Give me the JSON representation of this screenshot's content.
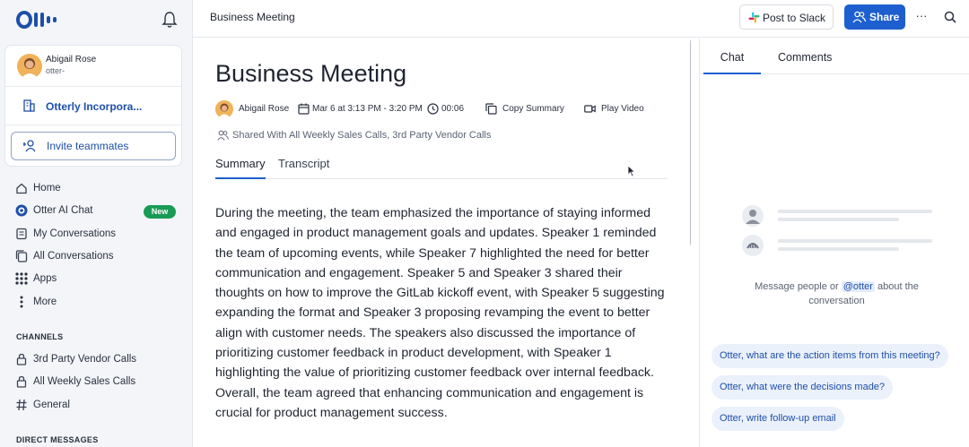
{
  "sidebar": {
    "user": {
      "name": "Abigail Rose",
      "handle": "otter-"
    },
    "org": {
      "name": "Otterly Incorpora..."
    },
    "invite_label": "Invite teammates",
    "nav": [
      {
        "label": "Home",
        "icon": "home-icon"
      },
      {
        "label": "Otter AI Chat",
        "icon": "otter-ai-icon",
        "badge": "New"
      },
      {
        "label": "My Conversations",
        "icon": "conversation-icon"
      },
      {
        "label": "All Conversations",
        "icon": "conversations-icon"
      },
      {
        "label": "Apps",
        "icon": "apps-grid-icon"
      },
      {
        "label": "More",
        "icon": "more-vertical-icon"
      }
    ],
    "channels_header": "CHANNELS",
    "channels": [
      {
        "label": "3rd Party Vendor Calls",
        "icon": "lock-icon"
      },
      {
        "label": "All Weekly Sales Calls",
        "icon": "lock-icon"
      },
      {
        "label": "General",
        "icon": "hash-icon"
      }
    ],
    "dm_header": "DIRECT MESSAGES"
  },
  "topbar": {
    "title": "Business Meeting",
    "slack_label": "Post to Slack",
    "share_label": "Share",
    "more_label": "···"
  },
  "meeting": {
    "title": "Business Meeting",
    "owner": "Abigail Rose",
    "datetime": "Mar 6 at 3:13 PM - 3:20 PM",
    "duration": "00:06",
    "copy_label": "Copy Summary",
    "play_label": "Play Video",
    "shared_with": "Shared With All Weekly Sales Calls, 3rd Party Vendor Calls",
    "tabs": [
      "Summary",
      "Transcript"
    ],
    "summary": "During the meeting, the team emphasized the importance of staying informed and engaged in product management goals and updates. Speaker 1 reminded the team of upcoming events, while Speaker 7 highlighted the need for better communication and engagement. Speaker 5 and Speaker 3 shared their thoughts on how to improve the GitLab kickoff event, with Speaker 5 suggesting expanding the format and Speaker 3 proposing revamping the event to better align with customer needs. The speakers also discussed the importance of prioritizing customer feedback in product development, with Speaker 1 highlighting the value of prioritizing customer feedback over internal feedback. Overall, the team agreed that enhancing communication and engagement is crucial for product management success."
  },
  "chat": {
    "tabs": [
      "Chat",
      "Comments"
    ],
    "empty_prefix": "Message people or ",
    "empty_mention": "@otter",
    "empty_suffix": " about the conversation",
    "suggestions": [
      "Otter, what are the action items from this meeting?",
      "Otter, what were the decisions made?",
      "Otter, write follow-up email"
    ]
  },
  "colors": {
    "accent": "#1e5fcf",
    "badge_green": "#1a9b55",
    "sidebar_bg": "#f3f5f9"
  }
}
